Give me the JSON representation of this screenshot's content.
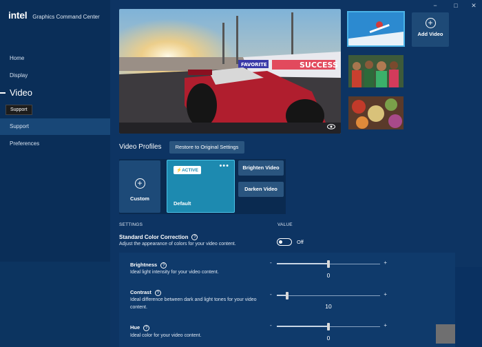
{
  "app": {
    "brand_logo": "intel",
    "title": "Graphics Command Center"
  },
  "window_controls": {
    "minimize": "−",
    "maximize": "□",
    "close": "✕"
  },
  "sidebar": {
    "items": [
      {
        "label": "Home"
      },
      {
        "label": "Display"
      },
      {
        "label": "Video",
        "active": true
      },
      {
        "label": "Support"
      },
      {
        "label": "Preferences"
      }
    ],
    "tooltip": "Support"
  },
  "media": {
    "add_video_label": "Add Video",
    "main_preview_banner": "FAVORITE",
    "main_preview_banner2": "SUCCESS"
  },
  "profiles": {
    "title": "Video Profiles",
    "restore_label": "Restore to Original Settings",
    "custom_label": "Custom",
    "default_label": "Default",
    "active_badge": "ACTIVE",
    "more_label": "•••",
    "brighten_label": "Brighten Video",
    "darken_label": "Darken Video"
  },
  "settings": {
    "settings_header": "SETTINGS",
    "value_header": "VALUE",
    "scc_title": "Standard Color Correction",
    "scc_desc": "Adjust the appearance of colors for your video content.",
    "scc_state": "Off",
    "help_glyph": "?",
    "minus": "-",
    "plus": "+",
    "items": [
      {
        "title": "Brightness",
        "desc": "Ideal light intensity for your video content.",
        "value": "0",
        "fraction": 0.5
      },
      {
        "title": "Contrast",
        "desc": "Ideal difference between dark and light tones for your video content.",
        "value": "10",
        "fraction": 0.1
      },
      {
        "title": "Hue",
        "desc": "Ideal color for your video content.",
        "value": "0",
        "fraction": 0.5
      }
    ]
  },
  "colors": {
    "background": "#0d3463",
    "sidebar": "#0a2e58",
    "accent": "#1d8ab0",
    "accent_border": "#4cc4ea"
  }
}
